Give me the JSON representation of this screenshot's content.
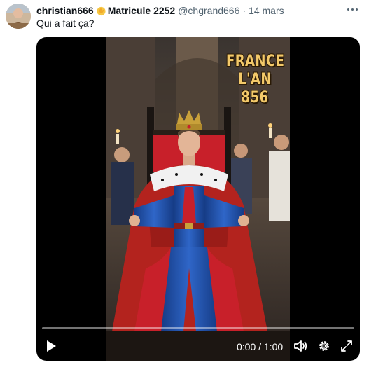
{
  "tweet": {
    "display_name": "christian666",
    "emoji_icon": "clapping-hands-icon",
    "display_name_suffix": "Matricule 2252",
    "handle": "@chgrand666",
    "separator": "·",
    "date": "14 mars",
    "text": "Qui a fait ça?",
    "more_icon": "more-icon"
  },
  "video": {
    "overlay_lines": [
      "FRANCE",
      "L'AN",
      "856"
    ],
    "current_time": "0:00",
    "time_separator": " / ",
    "duration": "1:00",
    "progress": 0.0,
    "icons": {
      "play": "play-icon",
      "volume": "volume-icon",
      "settings": "settings-gear-icon",
      "fullscreen": "fullscreen-icon"
    }
  },
  "colors": {
    "text_primary": "#0f1419",
    "text_secondary": "#536471",
    "robe_red": "#b3231e",
    "robe_blue": "#1f4fa8",
    "gold": "#c9a13a"
  }
}
